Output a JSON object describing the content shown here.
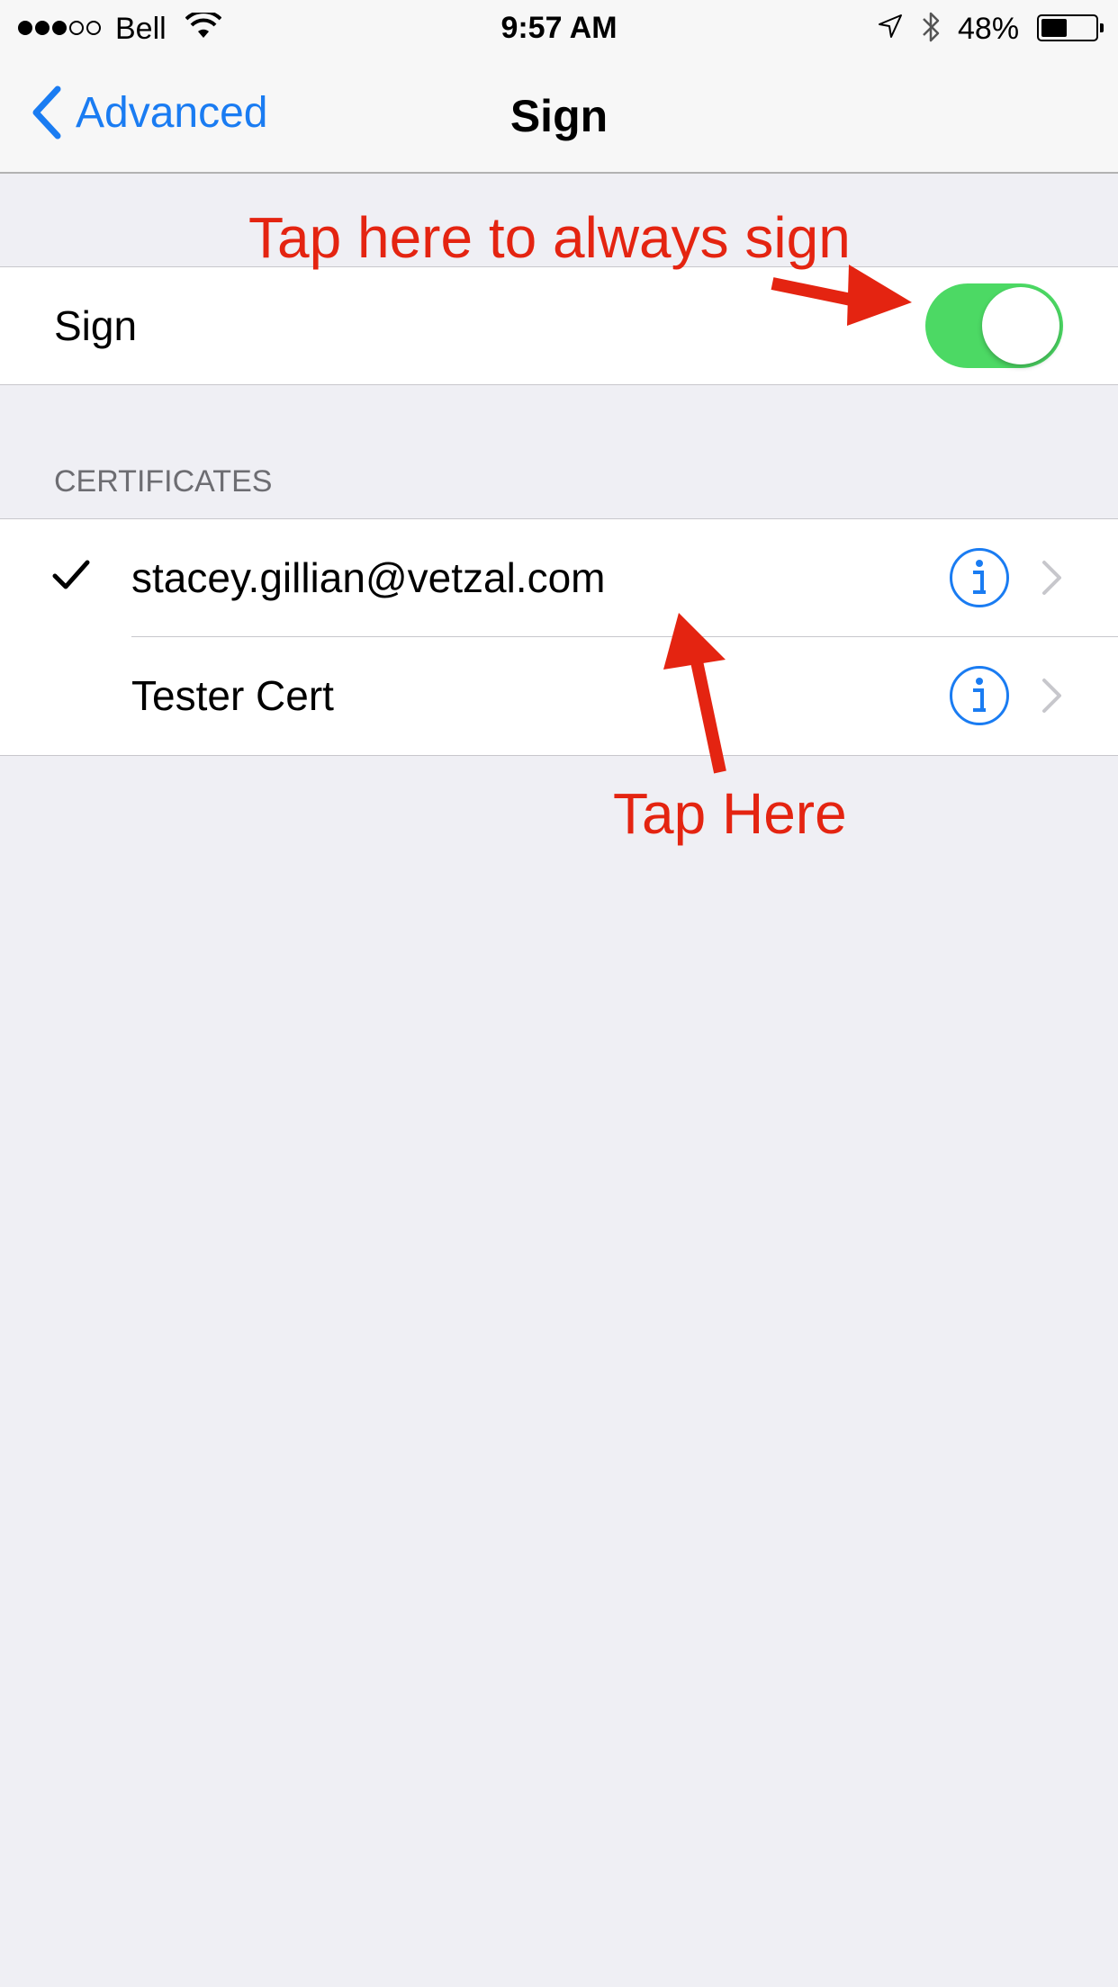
{
  "status_bar": {
    "carrier": "Bell",
    "time": "9:57 AM",
    "battery_percent": "48%",
    "signal_bars_filled": 3,
    "signal_bars_total": 5,
    "battery_level": 0.48,
    "icons": [
      "wifi-icon",
      "location-icon",
      "bluetooth-icon",
      "battery-icon"
    ]
  },
  "nav": {
    "back_label": "Advanced",
    "title": "Sign"
  },
  "sign_row": {
    "label": "Sign",
    "toggle_on": true,
    "toggle_color": "#4cd964"
  },
  "certificates": {
    "header": "CERTIFICATES",
    "items": [
      {
        "label": "stacey.gillian@vetzal.com",
        "checked": true
      },
      {
        "label": "Tester Cert",
        "checked": false
      }
    ]
  },
  "annotations": {
    "toggle_hint": "Tap here to always sign",
    "cert_hint": "Tap Here",
    "color": "#e42411"
  },
  "colors": {
    "accent": "#1a7cf2",
    "background": "#efeff4"
  }
}
